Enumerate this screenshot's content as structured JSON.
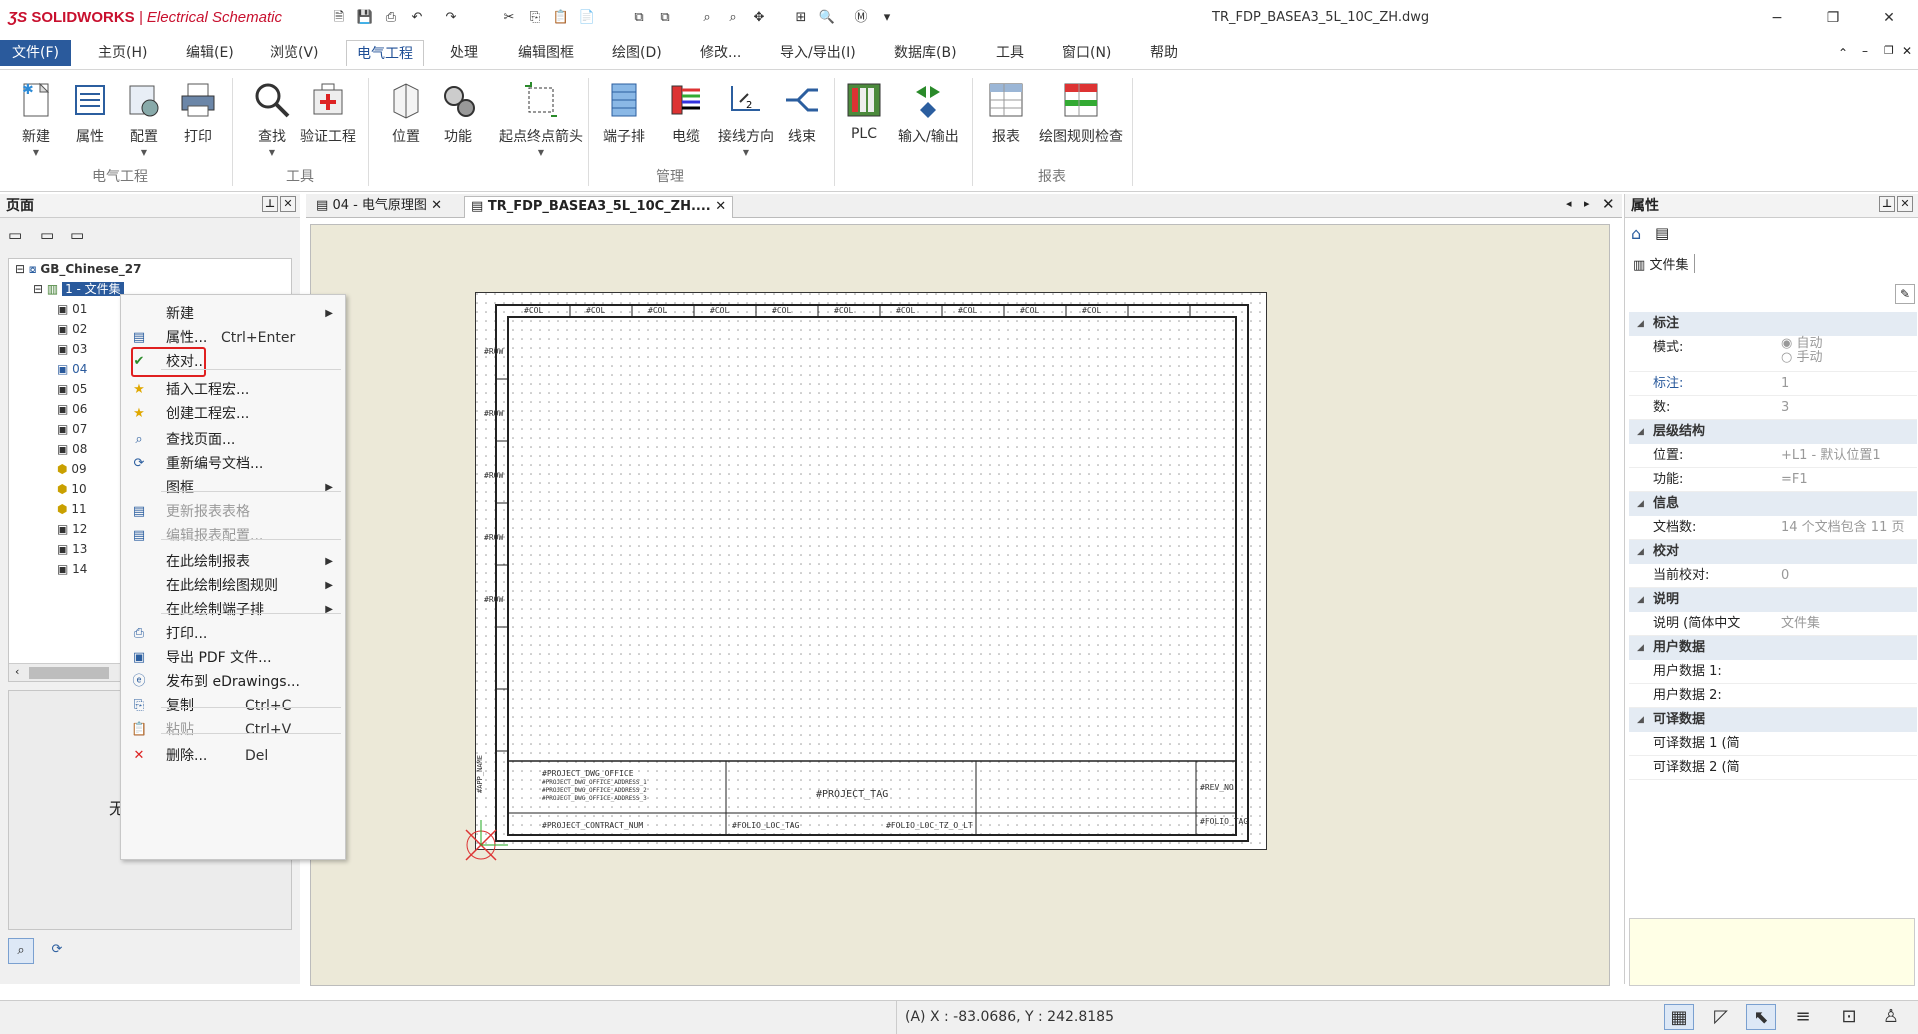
{
  "app": {
    "brand": "SOLIDWORKS",
    "product": "Electrical Schematic",
    "document_title": "TR_FDP_BASEA3_5L_10C_ZH.dwg"
  },
  "window_buttons": {
    "minimize": "−",
    "restore": "❐",
    "close": "✕"
  },
  "menubar": {
    "file": "文件(F)",
    "items": [
      "主页(H)",
      "编辑(E)",
      "浏览(V)",
      "电气工程",
      "处理",
      "编辑图框",
      "绘图(D)",
      "修改...",
      "导入/导出(I)",
      "数据库(B)",
      "工具",
      "窗口(N)",
      "帮助"
    ],
    "active": "电气工程"
  },
  "ribbon": {
    "buttons": [
      "新建",
      "属性",
      "配置",
      "打印",
      "查找",
      "验证工程",
      "位置",
      "功能",
      "起点终点箭头",
      "端子排",
      "电缆",
      "接线方向",
      "线束",
      "PLC",
      "输入/输出",
      "报表",
      "绘图规则检查"
    ],
    "groups": [
      "电气工程",
      "工具",
      "管理",
      "报表"
    ]
  },
  "left_panel": {
    "title": "页面",
    "tree_root": "GB_Chinese_27",
    "tree_book": "1 - 文件集",
    "tree_items": [
      "01",
      "02",
      "03",
      "04",
      "05",
      "06",
      "07",
      "08",
      "09",
      "10",
      "11",
      "12",
      "13",
      "14"
    ],
    "partial_text": "无"
  },
  "context_menu": {
    "items": [
      {
        "label": "新建",
        "shortcut": "",
        "submenu": true,
        "disabled": false
      },
      {
        "label": "属性...",
        "shortcut": "Ctrl+Enter",
        "submenu": false,
        "disabled": false
      },
      {
        "label": "校对...",
        "shortcut": "",
        "submenu": false,
        "disabled": false,
        "highlighted": true
      },
      {
        "label": "插入工程宏...",
        "shortcut": "",
        "submenu": false,
        "disabled": false
      },
      {
        "label": "创建工程宏...",
        "shortcut": "",
        "submenu": false,
        "disabled": false
      },
      {
        "label": "查找页面...",
        "shortcut": "",
        "submenu": false,
        "disabled": false
      },
      {
        "label": "重新编号文档...",
        "shortcut": "",
        "submenu": false,
        "disabled": false
      },
      {
        "label": "图框",
        "shortcut": "",
        "submenu": true,
        "disabled": false
      },
      {
        "label": "更新报表表格",
        "shortcut": "",
        "submenu": false,
        "disabled": true
      },
      {
        "label": "编辑报表配置...",
        "shortcut": "",
        "submenu": false,
        "disabled": true
      },
      {
        "label": "在此绘制报表",
        "shortcut": "",
        "submenu": true,
        "disabled": false
      },
      {
        "label": "在此绘制绘图规则",
        "shortcut": "",
        "submenu": true,
        "disabled": false
      },
      {
        "label": "在此绘制端子排",
        "shortcut": "",
        "submenu": true,
        "disabled": false
      },
      {
        "label": "打印...",
        "shortcut": "",
        "submenu": false,
        "disabled": false
      },
      {
        "label": "导出 PDF 文件...",
        "shortcut": "",
        "submenu": false,
        "disabled": false
      },
      {
        "label": "发布到 eDrawings...",
        "shortcut": "",
        "submenu": false,
        "disabled": false
      },
      {
        "label": "复制",
        "shortcut": "Ctrl+C",
        "submenu": false,
        "disabled": false
      },
      {
        "label": "粘贴",
        "shortcut": "Ctrl+V",
        "submenu": false,
        "disabled": true
      },
      {
        "label": "删除...",
        "shortcut": "Del",
        "submenu": false,
        "disabled": false
      }
    ],
    "highlight_color": "#e02020"
  },
  "doc_tabs": [
    {
      "label": "04 - 电气原理图"
    },
    {
      "label": "TR_FDP_BASEA3_5L_10C_ZH...."
    }
  ],
  "drawing": {
    "col_label": "#COL",
    "row_label": "#ROW",
    "title_block": {
      "office": "#PROJECT_DWG_OFFICE",
      "addr1": "#PROJECT_DWG_OFFICE_ADDRESS_1",
      "addr2": "#PROJECT_DWG_OFFICE_ADDRESS_2",
      "addr3": "#PROJECT_DWG_OFFICE_ADDRESS_3",
      "project_tag": "#PROJECT_TAG",
      "contract": "#PROJECT_CONTRACT_NUM",
      "folio_loc": "#FOLIO_LOC_TAG",
      "folio_loc_tz": "#FOLIO_LOC_TZ_O_LT",
      "rev_no": "#REV_NO",
      "folio_tag": "#FOLIO_TAG",
      "app_name": "#APP_NAME"
    }
  },
  "properties": {
    "title": "属性",
    "tab": "文件集",
    "sections": [
      {
        "name": "标注",
        "rows": [
          {
            "name": "模式:",
            "value": ""
          },
          {
            "name": "标注:",
            "value": "1",
            "link": true
          },
          {
            "name": "数:",
            "value": "3"
          }
        ]
      },
      {
        "name": "层级结构",
        "rows": [
          {
            "name": "位置:",
            "value": "+L1 - 默认位置1"
          },
          {
            "name": "功能:",
            "value": "=F1"
          }
        ]
      },
      {
        "name": "信息",
        "rows": [
          {
            "name": "文档数:",
            "value": "14 个文档包含 11 页"
          }
        ]
      },
      {
        "name": "校对",
        "rows": [
          {
            "name": "当前校对:",
            "value": "0"
          }
        ]
      },
      {
        "name": "说明",
        "rows": [
          {
            "name": "说明 (简体中文",
            "value": "文件集"
          }
        ]
      },
      {
        "name": "用户数据",
        "rows": [
          {
            "name": "用户数据 1:",
            "value": ""
          },
          {
            "name": "用户数据 2:",
            "value": ""
          }
        ]
      },
      {
        "name": "可译数据",
        "rows": [
          {
            "name": "可译数据 1 (简",
            "value": ""
          },
          {
            "name": "可译数据 2 (简",
            "value": ""
          }
        ]
      }
    ],
    "mode_options": [
      "自动",
      "手动"
    ]
  },
  "status": {
    "coords": "(A) X : -83.0686, Y : 242.8185"
  }
}
